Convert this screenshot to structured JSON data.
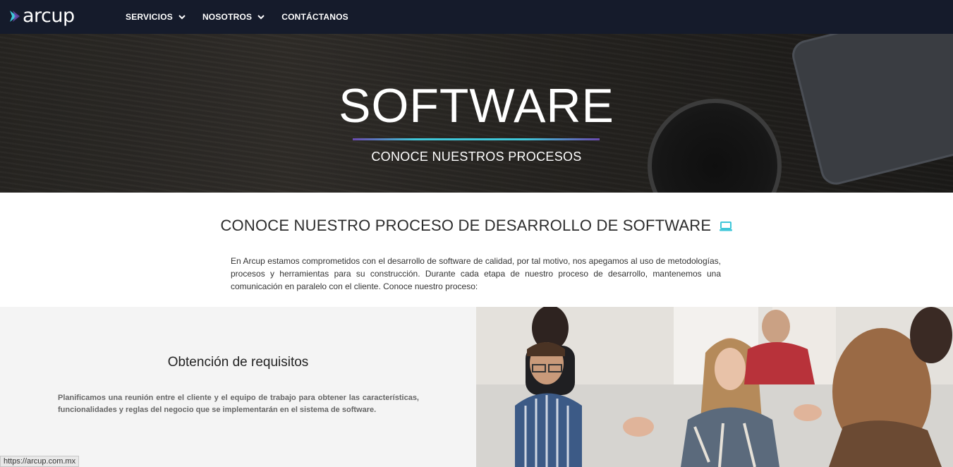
{
  "header": {
    "logo_text": "arcup",
    "nav": [
      {
        "label": "SERVICIOS",
        "has_dropdown": true
      },
      {
        "label": "NOSOTROS",
        "has_dropdown": true
      },
      {
        "label": "CONTÁCTANOS",
        "has_dropdown": false
      }
    ]
  },
  "hero": {
    "title": "SOFTWARE",
    "subtitle": "CONOCE NUESTROS PROCESOS"
  },
  "intro": {
    "heading": "CONOCE NUESTRO PROCESO DE DESARROLLO DE SOFTWARE",
    "icon": "laptop-icon",
    "text": "En Arcup estamos comprometidos con el desarrollo de software de calidad, por tal motivo, nos apegamos al uso de metodologías, procesos y herramientas para su construcción. Durante cada etapa de nuestro proceso de desarrollo, mantenemos una comunicación en paralelo con el cliente. Conoce nuestro proceso:"
  },
  "process": {
    "step_title": "Obtención de requisitos",
    "step_text": "Planificamos una reunión entre el cliente y el equipo de trabajo para obtener las características, funcionalidades y reglas del negocio que se implementarán en el sistema de software."
  },
  "status_bar": {
    "url": "https://arcup.com.mx"
  },
  "colors": {
    "nav_bg": "#151b2b",
    "accent_cyan": "#3fc7d9",
    "accent_purple": "#6a4ab0"
  }
}
